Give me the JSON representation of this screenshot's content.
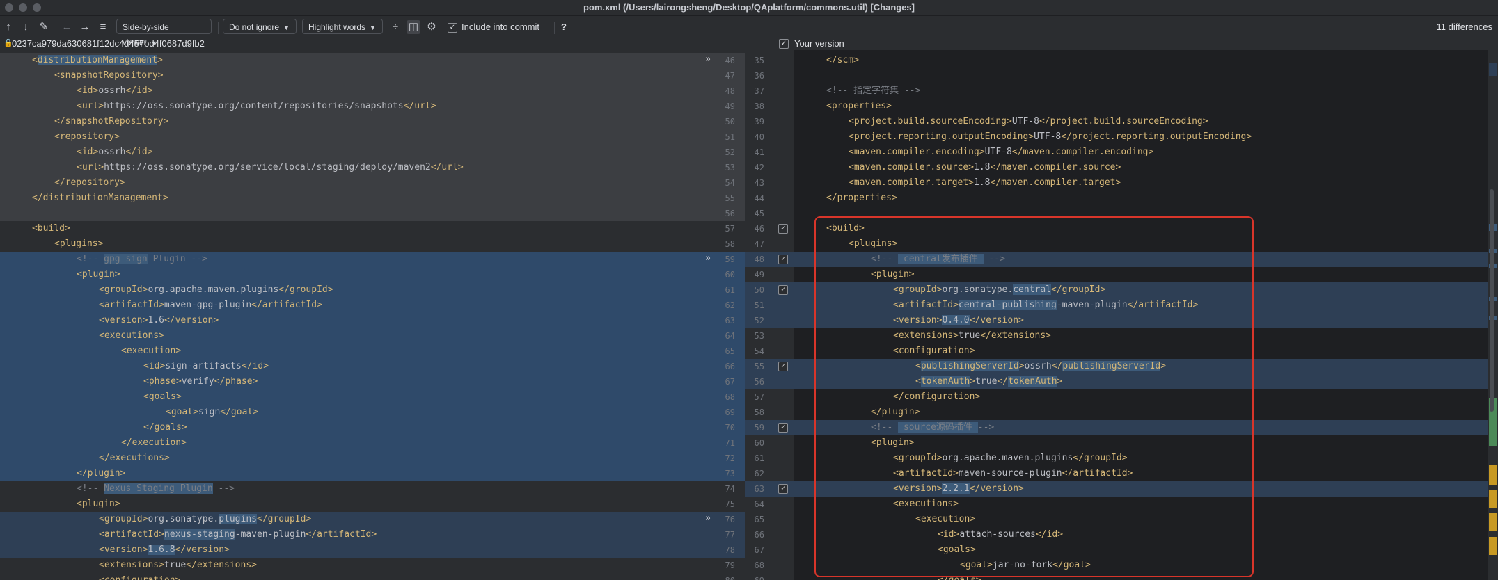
{
  "window": {
    "title": "pom.xml (/Users/lairongsheng/Desktop/QAplatform/commons.util) [Changes]"
  },
  "toolbar": {
    "viewer_label": "Side-by-side viewer",
    "ignore_label": "Do not ignore",
    "highlight_label": "Highlight words",
    "include_label": "Include into commit",
    "help_label": "?",
    "differences": "11 differences",
    "icons": [
      "arrow-up-icon",
      "arrow-down-icon",
      "edit-icon",
      "back-icon",
      "forward-icon",
      "list-icon",
      "collapse-icon",
      "side-by-side-icon",
      "gear-icon"
    ]
  },
  "left_header": {
    "hash": "0237ca979da630681f12dc4d457bd4f0687d9fb2"
  },
  "right_header": {
    "label": "Your version"
  },
  "colors": {
    "added": "#2f4a6a",
    "changed": "#2e3f55",
    "unchanged_left": "#3c3e42",
    "tag": "#d5b778",
    "red_box": "#d8352a"
  },
  "left_lines": [
    {
      "indent": 1,
      "parts": [
        {
          "c": "tag",
          "t": "<"
        },
        {
          "c": "hl",
          "t": "distributionManagement"
        },
        {
          "c": "tag",
          "t": ">"
        }
      ]
    },
    {
      "indent": 2,
      "parts": [
        {
          "c": "tag",
          "t": "<snapshotRepository>"
        }
      ]
    },
    {
      "indent": 3,
      "parts": [
        {
          "c": "tag",
          "t": "<id>"
        },
        {
          "c": "txt",
          "t": "ossrh"
        },
        {
          "c": "tag",
          "t": "</id>"
        }
      ]
    },
    {
      "indent": 3,
      "parts": [
        {
          "c": "tag",
          "t": "<url>"
        },
        {
          "c": "txt",
          "t": "https://oss.sonatype.org/content/repositories/snapshots"
        },
        {
          "c": "tag",
          "t": "</url>"
        }
      ]
    },
    {
      "indent": 2,
      "parts": [
        {
          "c": "tag",
          "t": "</snapshotRepository>"
        }
      ]
    },
    {
      "indent": 2,
      "parts": [
        {
          "c": "tag",
          "t": "<repository>"
        }
      ]
    },
    {
      "indent": 3,
      "parts": [
        {
          "c": "tag",
          "t": "<id>"
        },
        {
          "c": "txt",
          "t": "ossrh"
        },
        {
          "c": "tag",
          "t": "</id>"
        }
      ]
    },
    {
      "indent": 3,
      "parts": [
        {
          "c": "tag",
          "t": "<url>"
        },
        {
          "c": "txt",
          "t": "https://oss.sonatype.org/service/local/staging/deploy/maven2"
        },
        {
          "c": "tag",
          "t": "</url>"
        }
      ]
    },
    {
      "indent": 2,
      "parts": [
        {
          "c": "tag",
          "t": "</repository>"
        }
      ]
    },
    {
      "indent": 1,
      "parts": [
        {
          "c": "tag",
          "t": "</distributionManagement>"
        }
      ]
    },
    {
      "indent": 0,
      "parts": []
    },
    {
      "indent": 1,
      "parts": [
        {
          "c": "tag",
          "t": "<build>"
        }
      ]
    },
    {
      "indent": 2,
      "parts": [
        {
          "c": "tag",
          "t": "<plugins>"
        }
      ]
    },
    {
      "indent": 3,
      "parts": [
        {
          "c": "cmt",
          "t": "<!-- "
        },
        {
          "c": "cmth",
          "t": "gpg sign"
        },
        {
          "c": "cmt",
          "t": " Plugin -->"
        }
      ]
    },
    {
      "indent": 3,
      "parts": [
        {
          "c": "tag",
          "t": "<plugin>"
        }
      ]
    },
    {
      "indent": 4,
      "parts": [
        {
          "c": "tag",
          "t": "<groupId>"
        },
        {
          "c": "txt",
          "t": "org.apache.maven.plugins"
        },
        {
          "c": "tag",
          "t": "</groupId>"
        }
      ]
    },
    {
      "indent": 4,
      "parts": [
        {
          "c": "tag",
          "t": "<artifactId>"
        },
        {
          "c": "txt",
          "t": "maven-gpg-plugin"
        },
        {
          "c": "tag",
          "t": "</artifactId>"
        }
      ]
    },
    {
      "indent": 4,
      "parts": [
        {
          "c": "tag",
          "t": "<version>"
        },
        {
          "c": "txt",
          "t": "1.6"
        },
        {
          "c": "tag",
          "t": "</version>"
        }
      ]
    },
    {
      "indent": 4,
      "parts": [
        {
          "c": "tag",
          "t": "<executions>"
        }
      ]
    },
    {
      "indent": 5,
      "parts": [
        {
          "c": "tag",
          "t": "<execution>"
        }
      ]
    },
    {
      "indent": 6,
      "parts": [
        {
          "c": "tag",
          "t": "<id>"
        },
        {
          "c": "txt",
          "t": "sign-artifacts"
        },
        {
          "c": "tag",
          "t": "</id>"
        }
      ]
    },
    {
      "indent": 6,
      "parts": [
        {
          "c": "tag",
          "t": "<phase>"
        },
        {
          "c": "txt",
          "t": "verify"
        },
        {
          "c": "tag",
          "t": "</phase>"
        }
      ]
    },
    {
      "indent": 6,
      "parts": [
        {
          "c": "tag",
          "t": "<goals>"
        }
      ]
    },
    {
      "indent": 7,
      "parts": [
        {
          "c": "tag",
          "t": "<goal>"
        },
        {
          "c": "txt",
          "t": "sign"
        },
        {
          "c": "tag",
          "t": "</goal>"
        }
      ]
    },
    {
      "indent": 6,
      "parts": [
        {
          "c": "tag",
          "t": "</goals>"
        }
      ]
    },
    {
      "indent": 5,
      "parts": [
        {
          "c": "tag",
          "t": "</execution>"
        }
      ]
    },
    {
      "indent": 4,
      "parts": [
        {
          "c": "tag",
          "t": "</executions>"
        }
      ]
    },
    {
      "indent": 3,
      "parts": [
        {
          "c": "tag",
          "t": "</plugin>"
        }
      ]
    },
    {
      "indent": 3,
      "parts": [
        {
          "c": "cmt",
          "t": "<!-- "
        },
        {
          "c": "cmth",
          "t": "Nexus Staging Plugin"
        },
        {
          "c": "cmt",
          "t": " -->"
        }
      ]
    },
    {
      "indent": 3,
      "parts": [
        {
          "c": "tag",
          "t": "<plugin>"
        }
      ]
    },
    {
      "indent": 4,
      "parts": [
        {
          "c": "tag",
          "t": "<groupId>"
        },
        {
          "c": "txt",
          "t": "org.sonatype."
        },
        {
          "c": "txth",
          "t": "plugins"
        },
        {
          "c": "tag",
          "t": "</groupId>"
        }
      ]
    },
    {
      "indent": 4,
      "parts": [
        {
          "c": "tag",
          "t": "<artifactId>"
        },
        {
          "c": "txth",
          "t": "nexus-staging"
        },
        {
          "c": "txt",
          "t": "-maven-plugin"
        },
        {
          "c": "tag",
          "t": "</artifactId>"
        }
      ]
    },
    {
      "indent": 4,
      "parts": [
        {
          "c": "tag",
          "t": "<version>"
        },
        {
          "c": "txth",
          "t": "1.6.8"
        },
        {
          "c": "tag",
          "t": "</version>"
        }
      ]
    },
    {
      "indent": 4,
      "parts": [
        {
          "c": "tag",
          "t": "<extensions>"
        },
        {
          "c": "txt",
          "t": "true"
        },
        {
          "c": "tag",
          "t": "</extensions>"
        }
      ]
    },
    {
      "indent": 4,
      "parts": [
        {
          "c": "tag",
          "t": "<configuration>"
        }
      ]
    }
  ],
  "right_lines": [
    {
      "indent": 1,
      "parts": [
        {
          "c": "tag",
          "t": "</scm>"
        }
      ]
    },
    {
      "indent": 0,
      "parts": []
    },
    {
      "indent": 1,
      "parts": [
        {
          "c": "cmt",
          "t": "<!-- 指定字符集 -->"
        }
      ]
    },
    {
      "indent": 1,
      "parts": [
        {
          "c": "tag",
          "t": "<properties>"
        }
      ]
    },
    {
      "indent": 2,
      "parts": [
        {
          "c": "tag",
          "t": "<project.build.sourceEncoding>"
        },
        {
          "c": "txt",
          "t": "UTF-8"
        },
        {
          "c": "tag",
          "t": "</project.build.sourceEncoding>"
        }
      ]
    },
    {
      "indent": 2,
      "parts": [
        {
          "c": "tag",
          "t": "<project.reporting.outputEncoding>"
        },
        {
          "c": "txt",
          "t": "UTF-8"
        },
        {
          "c": "tag",
          "t": "</project.reporting.outputEncoding>"
        }
      ]
    },
    {
      "indent": 2,
      "parts": [
        {
          "c": "tag",
          "t": "<maven.compiler.encoding>"
        },
        {
          "c": "txt",
          "t": "UTF-8"
        },
        {
          "c": "tag",
          "t": "</maven.compiler.encoding>"
        }
      ]
    },
    {
      "indent": 2,
      "parts": [
        {
          "c": "tag",
          "t": "<maven.compiler.source>"
        },
        {
          "c": "txt",
          "t": "1.8"
        },
        {
          "c": "tag",
          "t": "</maven.compiler.source>"
        }
      ]
    },
    {
      "indent": 2,
      "parts": [
        {
          "c": "tag",
          "t": "<maven.compiler.target>"
        },
        {
          "c": "txt",
          "t": "1.8"
        },
        {
          "c": "tag",
          "t": "</maven.compiler.target>"
        }
      ]
    },
    {
      "indent": 1,
      "parts": [
        {
          "c": "tag",
          "t": "</properties>"
        }
      ]
    },
    {
      "indent": 0,
      "parts": []
    },
    {
      "indent": 1,
      "parts": [
        {
          "c": "tag",
          "t": "<build>"
        }
      ]
    },
    {
      "indent": 2,
      "parts": [
        {
          "c": "tag",
          "t": "<plugins>"
        }
      ]
    },
    {
      "indent": 3,
      "parts": [
        {
          "c": "cmt",
          "t": "<!-- "
        },
        {
          "c": "cmth",
          "t": " central发布插件 "
        },
        {
          "c": "cmt",
          "t": " -->"
        }
      ]
    },
    {
      "indent": 3,
      "parts": [
        {
          "c": "tag",
          "t": "<plugin>"
        }
      ]
    },
    {
      "indent": 4,
      "parts": [
        {
          "c": "tag",
          "t": "<groupId>"
        },
        {
          "c": "txt",
          "t": "org.sonatype."
        },
        {
          "c": "txth",
          "t": "central"
        },
        {
          "c": "tag",
          "t": "</groupId>"
        }
      ]
    },
    {
      "indent": 4,
      "parts": [
        {
          "c": "tag",
          "t": "<artifactId>"
        },
        {
          "c": "txth",
          "t": "central-publishing"
        },
        {
          "c": "txt",
          "t": "-maven-plugin"
        },
        {
          "c": "tag",
          "t": "</artifactId>"
        }
      ]
    },
    {
      "indent": 4,
      "parts": [
        {
          "c": "tag",
          "t": "<version>"
        },
        {
          "c": "txth",
          "t": "0.4.0"
        },
        {
          "c": "tag",
          "t": "</version>"
        }
      ]
    },
    {
      "indent": 4,
      "parts": [
        {
          "c": "tag",
          "t": "<extensions>"
        },
        {
          "c": "txt",
          "t": "true"
        },
        {
          "c": "tag",
          "t": "</extensions>"
        }
      ]
    },
    {
      "indent": 4,
      "parts": [
        {
          "c": "tag",
          "t": "<configuration>"
        }
      ]
    },
    {
      "indent": 5,
      "parts": [
        {
          "c": "tag",
          "t": "<"
        },
        {
          "c": "tagh",
          "t": "publishingServerId"
        },
        {
          "c": "tag",
          "t": ">"
        },
        {
          "c": "txt",
          "t": "ossrh"
        },
        {
          "c": "tag",
          "t": "</"
        },
        {
          "c": "tagh",
          "t": "publishingServerId"
        },
        {
          "c": "tag",
          "t": ">"
        }
      ]
    },
    {
      "indent": 5,
      "parts": [
        {
          "c": "tag",
          "t": "<"
        },
        {
          "c": "tagh",
          "t": "tokenAuth"
        },
        {
          "c": "tag",
          "t": ">"
        },
        {
          "c": "txt",
          "t": "true"
        },
        {
          "c": "tag",
          "t": "</"
        },
        {
          "c": "tagh",
          "t": "tokenAuth"
        },
        {
          "c": "tag",
          "t": ">"
        }
      ]
    },
    {
      "indent": 4,
      "parts": [
        {
          "c": "tag",
          "t": "</configuration>"
        }
      ]
    },
    {
      "indent": 3,
      "parts": [
        {
          "c": "tag",
          "t": "</plugin>"
        }
      ]
    },
    {
      "indent": 3,
      "parts": [
        {
          "c": "cmt",
          "t": "<!-- "
        },
        {
          "c": "cmth",
          "t": " source源码插件 "
        },
        {
          "c": "cmt",
          "t": "-->"
        }
      ]
    },
    {
      "indent": 3,
      "parts": [
        {
          "c": "tag",
          "t": "<plugin>"
        }
      ]
    },
    {
      "indent": 4,
      "parts": [
        {
          "c": "tag",
          "t": "<groupId>"
        },
        {
          "c": "txt",
          "t": "org.apache.maven.plugins"
        },
        {
          "c": "tag",
          "t": "</groupId>"
        }
      ]
    },
    {
      "indent": 4,
      "parts": [
        {
          "c": "tag",
          "t": "<artifactId>"
        },
        {
          "c": "txt",
          "t": "maven-source-plugin"
        },
        {
          "c": "tag",
          "t": "</artifactId>"
        }
      ]
    },
    {
      "indent": 4,
      "parts": [
        {
          "c": "tag",
          "t": "<version>"
        },
        {
          "c": "txth",
          "t": "2.2.1"
        },
        {
          "c": "tag",
          "t": "</version>"
        }
      ]
    },
    {
      "indent": 4,
      "parts": [
        {
          "c": "tag",
          "t": "<executions>"
        }
      ]
    },
    {
      "indent": 5,
      "parts": [
        {
          "c": "tag",
          "t": "<execution>"
        }
      ]
    },
    {
      "indent": 6,
      "parts": [
        {
          "c": "tag",
          "t": "<id>"
        },
        {
          "c": "txt",
          "t": "attach-sources"
        },
        {
          "c": "tag",
          "t": "</id>"
        }
      ]
    },
    {
      "indent": 6,
      "parts": [
        {
          "c": "tag",
          "t": "<goals>"
        }
      ]
    },
    {
      "indent": 7,
      "parts": [
        {
          "c": "tag",
          "t": "<goal>"
        },
        {
          "c": "txt",
          "t": "jar-no-fork"
        },
        {
          "c": "tag",
          "t": "</goal>"
        }
      ]
    },
    {
      "indent": 6,
      "parts": [
        {
          "c": "tag",
          "t": "</goals>"
        }
      ]
    }
  ],
  "left_line_numbers": [
    "46",
    "47",
    "48",
    "49",
    "50",
    "51",
    "52",
    "53",
    "54",
    "55",
    "56",
    "57",
    "58",
    "59",
    "60",
    "61",
    "62",
    "63",
    "64",
    "65",
    "66",
    "67",
    "68",
    "69",
    "70",
    "71",
    "72",
    "73",
    "74",
    "75",
    "76",
    "77",
    "78",
    "79",
    "80"
  ],
  "right_line_numbers": [
    "35",
    "36",
    "37",
    "38",
    "39",
    "40",
    "41",
    "42",
    "43",
    "44",
    "45",
    "46",
    "47",
    "48",
    "49",
    "50",
    "51",
    "52",
    "53",
    "54",
    "55",
    "56",
    "57",
    "58",
    "59",
    "60",
    "61",
    "62",
    "63",
    "64",
    "65",
    "66",
    "67",
    "68",
    "69"
  ]
}
